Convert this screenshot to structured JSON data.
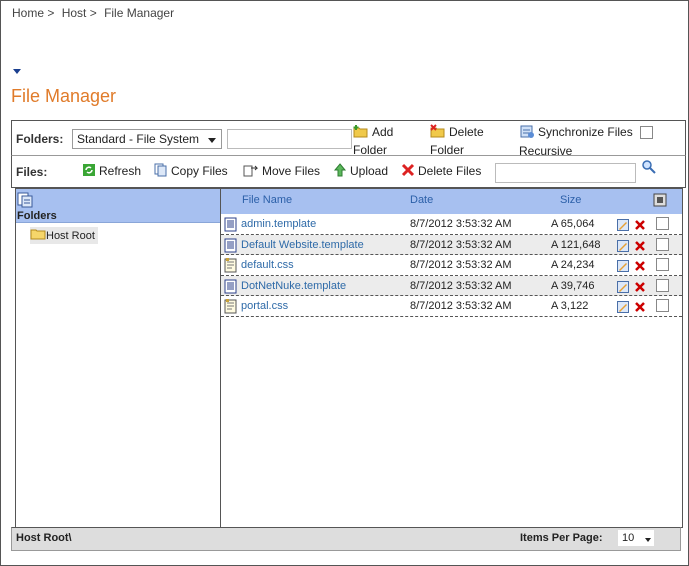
{
  "breadcrumb": [
    "Home >",
    "Host >",
    "File Manager"
  ],
  "page_title": "File Manager",
  "toolbar": {
    "folders_label": "Folders:",
    "folder_select_value": "Standard - File System",
    "folder_input_value": "",
    "add_folder_line1": "Add",
    "add_folder_line2": "Folder",
    "delete_folder_line1": "Delete",
    "delete_folder_line2": "Folder",
    "sync_label": "Synchronize Files",
    "recursive_label": "Recursive",
    "files_label": "Files:",
    "refresh_label": "Refresh",
    "copy_label": "Copy Files",
    "move_label": "Move Files",
    "upload_label": "Upload",
    "delete_files_label": "Delete Files",
    "files_search_value": ""
  },
  "tree": {
    "header": "Folders",
    "root": "Host Root"
  },
  "grid": {
    "columns": [
      "File Name",
      "Date",
      "Size"
    ],
    "rows": [
      {
        "name": "admin.template",
        "date": "8/7/2012 3:53:32 AM",
        "size": "A 65,064",
        "type": "template"
      },
      {
        "name": "Default Website.template",
        "date": "8/7/2012 3:53:32 AM",
        "size": "A 121,648",
        "type": "template"
      },
      {
        "name": "default.css",
        "date": "8/7/2012 3:53:32 AM",
        "size": "A 24,234",
        "type": "css"
      },
      {
        "name": "DotNetNuke.template",
        "date": "8/7/2012 3:53:32 AM",
        "size": "A 39,746",
        "type": "template"
      },
      {
        "name": "portal.css",
        "date": "8/7/2012 3:53:32 AM",
        "size": "A 3,122",
        "type": "css"
      }
    ]
  },
  "footer": {
    "path": "Host Root\\",
    "items_per_page_label": "Items Per Page:",
    "items_per_page_value": "10"
  },
  "colors": {
    "title": "#e07b2a",
    "header_blue": "#a7c0f0",
    "link": "#2e6aa8"
  }
}
